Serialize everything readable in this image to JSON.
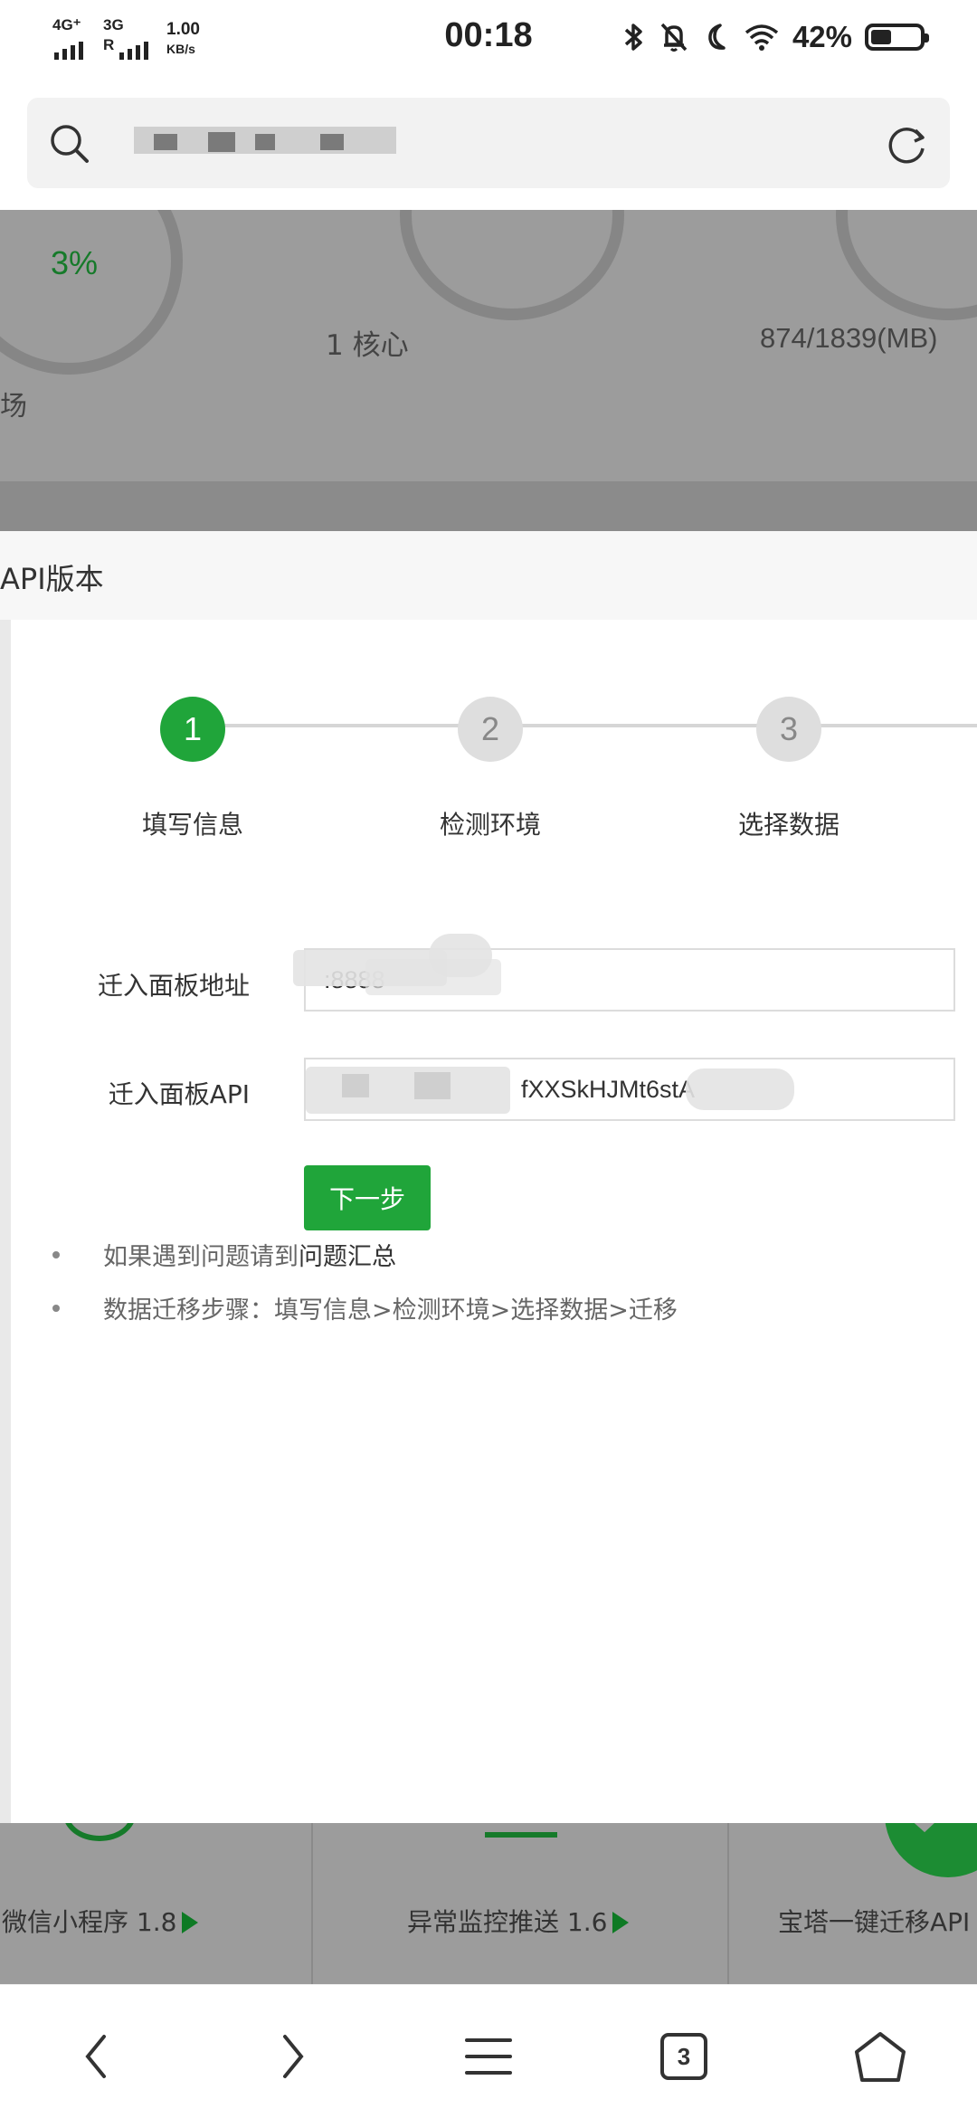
{
  "status_bar": {
    "network_left_top": "4G⁺",
    "network_right_top": "3G",
    "network_r": "R",
    "speed_value": "1.00",
    "speed_unit": "KB/s",
    "time": "00:18",
    "battery_percent": "42%",
    "battery_level": 0.42
  },
  "browser": {
    "tab_count": "3"
  },
  "dashboard": {
    "load_percent": "3%",
    "load_label_fragment": "场",
    "cpu_label": "1 核心",
    "memory_label": "874/1839(MB)"
  },
  "page_header": {
    "title": "API版本"
  },
  "steps": [
    {
      "number": "1",
      "label": "填写信息"
    },
    {
      "number": "2",
      "label": "检测环境"
    },
    {
      "number": "3",
      "label": "选择数据"
    }
  ],
  "form": {
    "address_label": "迁入面板地址",
    "address_value": ":8888",
    "api_label": "迁入面板API",
    "api_value": "fXXSkHJMt6stA",
    "next_button": "下一步"
  },
  "tips": {
    "tip1_prefix": "如果遇到问题请到",
    "tip1_link": "问题汇总",
    "tip2": "数据迁移步骤：填写信息>检测环境>选择数据>迁移"
  },
  "apps": [
    {
      "label": "微信小程序 1.8"
    },
    {
      "label": "异常监控推送 1.6"
    },
    {
      "label": "宝塔一键迁移API"
    }
  ],
  "colors": {
    "accent": "#20a53a",
    "overlay": "#9c9c9c"
  }
}
